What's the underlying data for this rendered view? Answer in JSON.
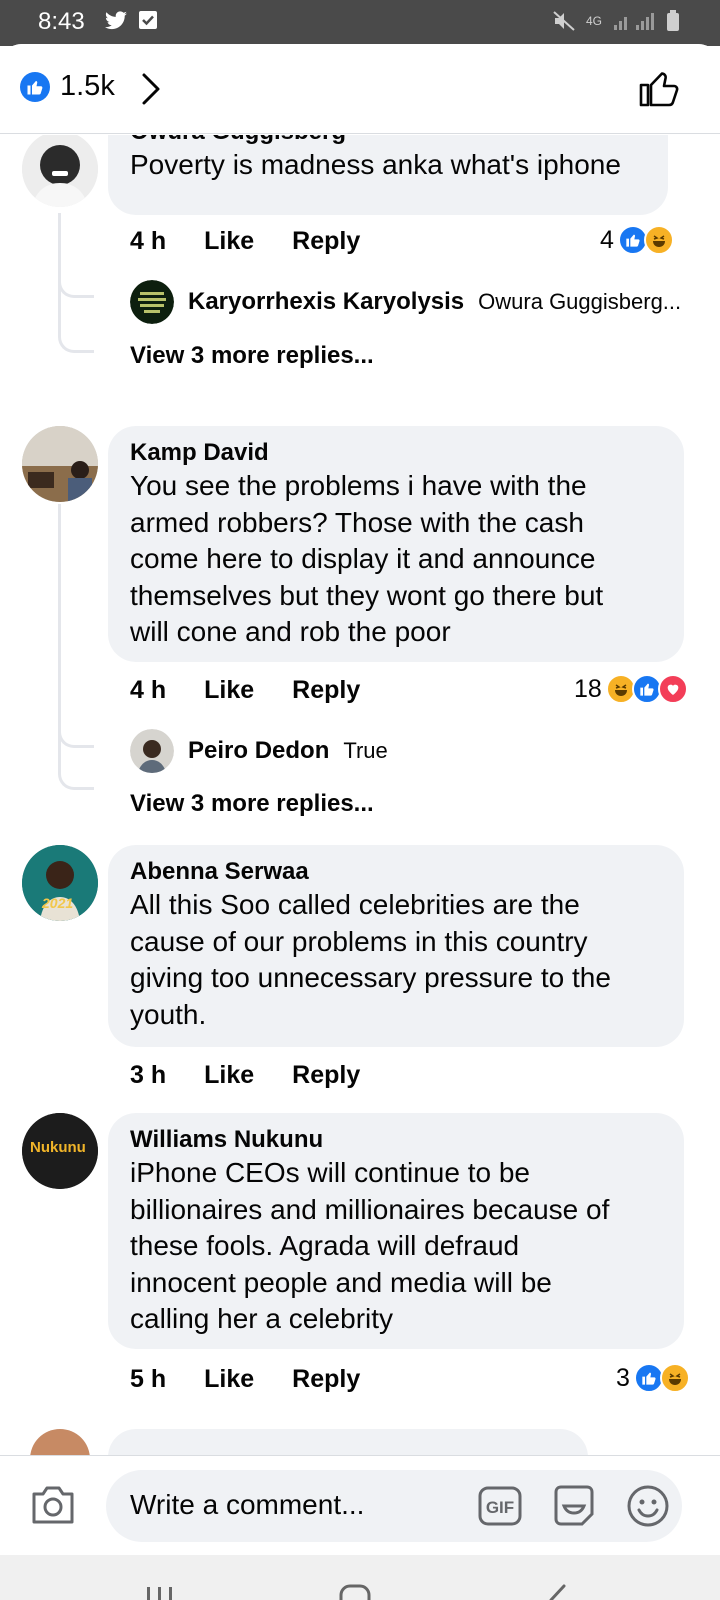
{
  "status_bar": {
    "time": "8:43",
    "network": "4G"
  },
  "header": {
    "like_count": "1.5k"
  },
  "comments": [
    {
      "author": "Owura Guggisberg",
      "text": "Poverty is madness anka what's iphone",
      "time": "4 h",
      "like": "Like",
      "reply": "Reply",
      "reaction_count": "4",
      "replies": [
        {
          "author": "Karyorrhexis Karyolysis",
          "text": "Owura Guggisberg..."
        }
      ],
      "more_replies": "View 3 more replies..."
    },
    {
      "author": "Kamp David",
      "text_lines": [
        "You see  the problems i have with the",
        "armed robbers? Those with the cash",
        "come here to display it and announce",
        "themselves but they wont go there but",
        "will cone and rob the poor"
      ],
      "time": "4 h",
      "like": "Like",
      "reply": "Reply",
      "reaction_count": "18",
      "replies": [
        {
          "author": "Peiro Dedon",
          "text": "True"
        }
      ],
      "more_replies": "View 3 more replies..."
    },
    {
      "author": "Abenna Serwaa",
      "text_lines": [
        "All this Soo called celebrities are the",
        "cause of our problems in this country",
        "giving too unnecessary pressure to the",
        "youth."
      ],
      "time": "3 h",
      "like": "Like",
      "reply": "Reply",
      "avatar_text": "2021"
    },
    {
      "author": "Williams Nukunu",
      "text_lines": [
        "iPhone CEOs will continue to be",
        "billionaires and millionaires because of",
        "these fools. Agrada will defraud",
        "innocent people and media will be",
        "calling her a celebrity"
      ],
      "time": "5 h",
      "like": "Like",
      "reply": "Reply",
      "reaction_count": "3",
      "avatar_text": "Nukunu"
    }
  ],
  "composer": {
    "placeholder": "Write a comment...",
    "gif_label": "GIF"
  },
  "colors": {
    "brand_blue": "#1877f2",
    "bubble_gray": "#f0f2f5",
    "haha_yellow": "#f7b125",
    "love_red": "#f33e58"
  }
}
